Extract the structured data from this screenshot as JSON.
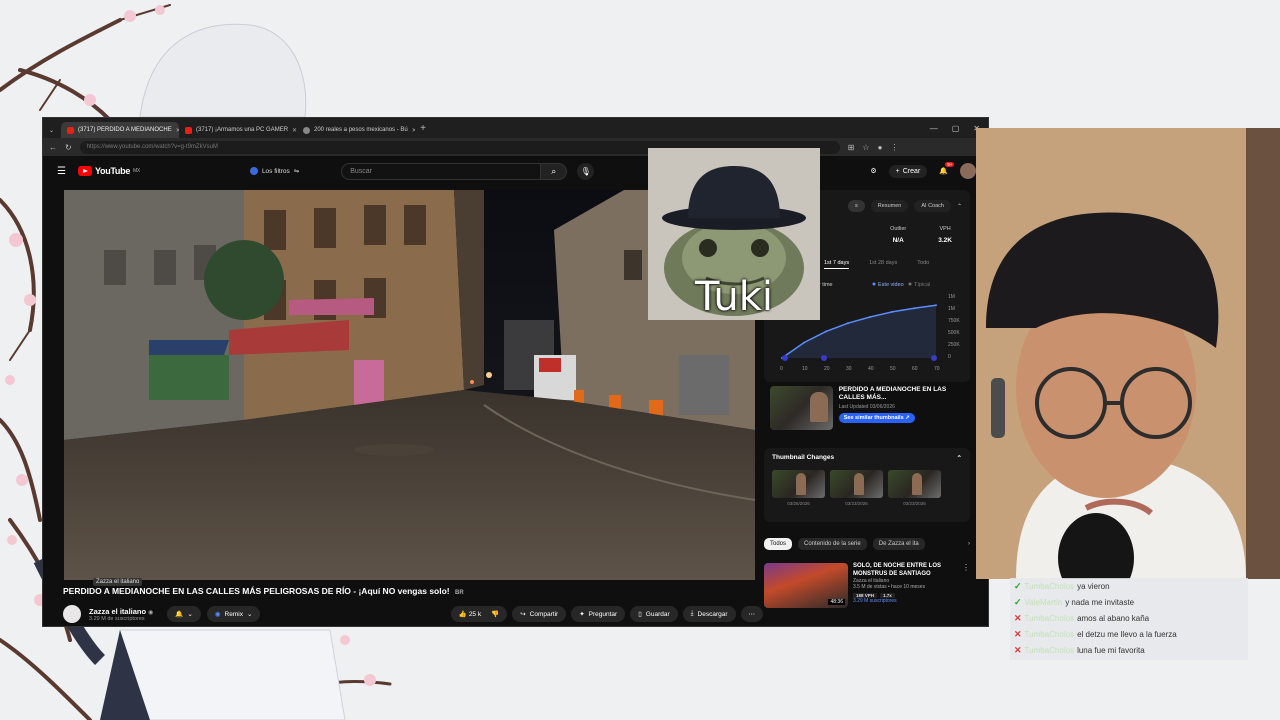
{
  "browser": {
    "tabs": [
      {
        "label": "(3717) PERDIDO A MEDIANOCHE",
        "active": true
      },
      {
        "label": "(3717) ¡Armamos una PC GAMER",
        "active": false
      },
      {
        "label": "200 reales a pesos mexicanos - Bú",
        "active": false
      }
    ],
    "url": "https://www.youtube.com/watch?v=g-t9mZkVsuM"
  },
  "youtube": {
    "logo_text": "YouTube",
    "region": "MX",
    "filters_label": "Los filtros",
    "search_placeholder": "Buscar",
    "create_label": "Crear",
    "notif_count": "9+"
  },
  "video": {
    "title": "PERDIDO A MEDIANOCHE EN LAS CALLES MÁS PELIGROSAS DE RÍO - ¡Aquí NO vengas solo! ",
    "title_badge": "BR",
    "tooltip": "Zazza el italiano",
    "channel_name": "Zazza el italiano",
    "subscribers": "3.29 M de suscriptores",
    "remix_label": "Remix",
    "likes": "25 k",
    "share_label": "Compartir",
    "ask_label": "Preguntar",
    "save_label": "Guardar",
    "download_label": "Descargar"
  },
  "stats_panel": {
    "tabs": [
      "s",
      "Resumen",
      "AI Coach"
    ],
    "outlier_label": "Outlier",
    "outlier_value": "N/A",
    "vph_label": "VPH",
    "vph_value": "3.2K",
    "ranges": [
      "1st 7 days",
      "1st 28 days",
      "Todo"
    ],
    "dropdown_label": "over time",
    "legend_this": "Este video",
    "legend_typical": "Típical"
  },
  "chart_data": {
    "type": "line",
    "x": [
      0,
      10,
      20,
      30,
      40,
      50,
      60,
      70
    ],
    "xticks": [
      "0",
      "10",
      "20",
      "30",
      "40",
      "50",
      "60",
      "70"
    ],
    "yticks": [
      "1M",
      "1M",
      "750K",
      "500K",
      "250K",
      "0"
    ],
    "ylim": [
      0,
      1250000
    ],
    "series": [
      {
        "name": "Este video",
        "values": [
          0,
          300000,
          520000,
          680000,
          800000,
          900000,
          970000,
          1030000
        ],
        "color": "#5b8cff"
      }
    ]
  },
  "thumbnail_card": {
    "title": "PERDIDO A MEDIANOCHE EN LAS CALLES MÁS...",
    "updated": "Last Updated 03/06/2026",
    "button": "See similar thumbnails"
  },
  "thumbnail_changes": {
    "heading": "Thumbnail Changes",
    "dates": [
      "03/26/2026",
      "03/23/2026",
      "03/23/2026"
    ]
  },
  "recommend": {
    "chips": [
      "Todos",
      "Contenido de la serie",
      "De Zazza el ita"
    ],
    "title": "SOLO, DE NOCHE ENTRE LOS MONSTRUS DE SANTIAGO",
    "channel": "Zazza el italiano",
    "meta": "3.5 M de vistas • hace 10 meses",
    "duration": "48:36",
    "tags": [
      "188 VPH",
      "1.7x"
    ],
    "subs": "3.29 M suscriptores"
  },
  "frog_overlay": {
    "text": "Tuki"
  },
  "chat": {
    "messages": [
      {
        "mark": "✓",
        "mark_color": "#2e9e2e",
        "user": "TumbaCholos",
        "text": "ya vieron"
      },
      {
        "mark": "✓",
        "mark_color": "#2e9e2e",
        "user": "ValeMartin",
        "text": "y nada me invitaste"
      },
      {
        "mark": "✕",
        "mark_color": "#d63a3a",
        "user": "TumbaCholos",
        "text": "amos al abano kaña"
      },
      {
        "mark": "✕",
        "mark_color": "#d63a3a",
        "user": "TumbaCholos",
        "text": "el detzu me llevo a la fuerza"
      },
      {
        "mark": "✕",
        "mark_color": "#d63a3a",
        "user": "TumbaCholos",
        "text": "luna fue mi favorita"
      }
    ]
  }
}
